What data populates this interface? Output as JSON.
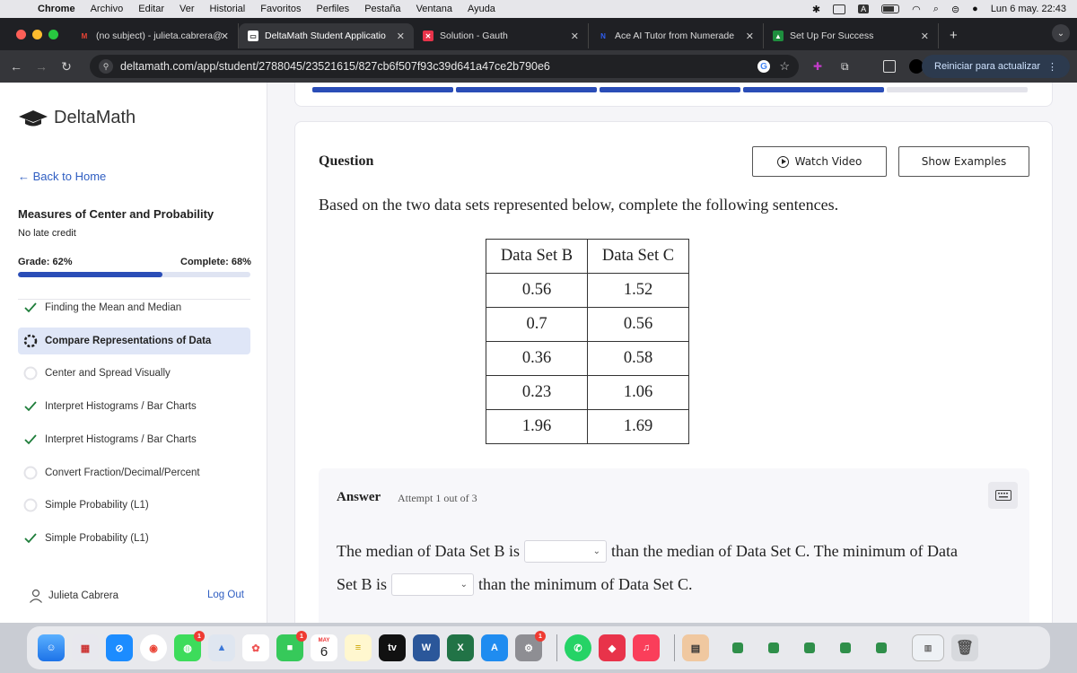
{
  "menubar": {
    "app": "Chrome",
    "items": [
      "Archivo",
      "Editar",
      "Ver",
      "Historial",
      "Favoritos",
      "Perfiles",
      "Pestaña",
      "Ventana",
      "Ayuda"
    ],
    "input_badge": "A",
    "clock": "Lun 6 may.  22:43"
  },
  "tabs": [
    {
      "title": "(no subject) - julieta.cabrera@",
      "favicon": "M",
      "color": "#ea4335"
    },
    {
      "title": "DeltaMath Student Applicatio",
      "favicon": "▭",
      "color": "#ffffff"
    },
    {
      "title": "Solution - Gauth",
      "favicon": "✕",
      "color": "#e8334a"
    },
    {
      "title": "Ace AI Tutor from Numerade",
      "favicon": "N",
      "color": "#1d3fbf"
    },
    {
      "title": "Set Up For Success",
      "favicon": "▲",
      "color": "#1e8e3e"
    }
  ],
  "toolbar": {
    "url": "deltamath.com/app/student/2788045/23521615/827cb6f507f93c39d641a47ce2b790e6",
    "update_label": "Reiniciar para actualizar"
  },
  "sidebar": {
    "logo_text": "DeltaMath",
    "back_label": "Back to Home",
    "assignment_title": "Measures of Center and Probability",
    "late_policy": "No late credit",
    "grade_label": "Grade: 62%",
    "complete_label": "Complete: 68%",
    "complete_fraction": 0.62,
    "skills": [
      {
        "label": "Finding the Mean and Median",
        "status": "done"
      },
      {
        "label": "Compare Representations of Data",
        "status": "current"
      },
      {
        "label": "Center and Spread Visually",
        "status": "todo"
      },
      {
        "label": "Interpret Histograms / Bar Charts",
        "status": "done"
      },
      {
        "label": "Interpret Histograms / Bar Charts",
        "status": "done"
      },
      {
        "label": "Convert Fraction/Decimal/Percent",
        "status": "todo"
      },
      {
        "label": "Simple Probability (L1)",
        "status": "todo"
      },
      {
        "label": "Simple Probability (L1)",
        "status": "done"
      }
    ],
    "user_name": "Julieta Cabrera",
    "logout_label": "Log Out"
  },
  "main": {
    "steps_filled": 4,
    "steps_total": 5,
    "question_label": "Question",
    "watch_video_label": "Watch Video",
    "show_examples_label": "Show Examples",
    "prompt": "Based on the two data sets represented below, complete the following sentences.",
    "table": {
      "headers": [
        "Data Set B",
        "Data Set C"
      ],
      "rows": [
        [
          "0.56",
          "1.52"
        ],
        [
          "0.7",
          "0.56"
        ],
        [
          "0.36",
          "0.58"
        ],
        [
          "0.23",
          "1.06"
        ],
        [
          "1.96",
          "1.69"
        ]
      ]
    },
    "answer": {
      "label": "Answer",
      "attempt": "Attempt 1 out of 3",
      "line1_pre": "The median of Data Set B is",
      "line1_post": "than the median of Data Set C. The minimum of Data",
      "line2_pre": "Set B is",
      "line2_post": "than the minimum of Data Set C."
    }
  },
  "dock": {
    "calendar_month": "MAY",
    "calendar_day": "6",
    "tv_label": "tv",
    "word_label": "W",
    "excel_label": "X",
    "badges": [
      "1",
      "1",
      "1"
    ]
  }
}
